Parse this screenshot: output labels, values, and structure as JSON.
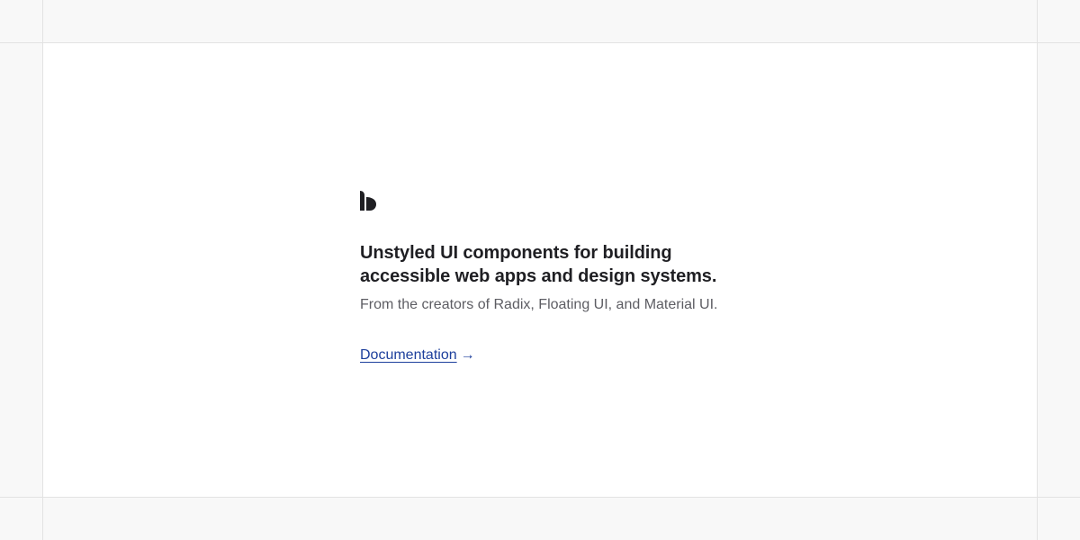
{
  "brand": {
    "logo_icon": "base-ui-logo-icon",
    "colors": {
      "text": "#1f1f23",
      "muted": "#5d5d63",
      "link": "#1d3f9c",
      "background": "#f8f8f8",
      "panel": "#ffffff",
      "grid_line": "#e3e3e3"
    }
  },
  "hero": {
    "headline_line1": "Unstyled UI components for building",
    "headline_line2": "accessible web apps and design systems.",
    "subline": "From the creators of Radix, Floating UI, and Material UI.",
    "doc_link_label": "Documentation",
    "doc_link_arrow": "→"
  }
}
